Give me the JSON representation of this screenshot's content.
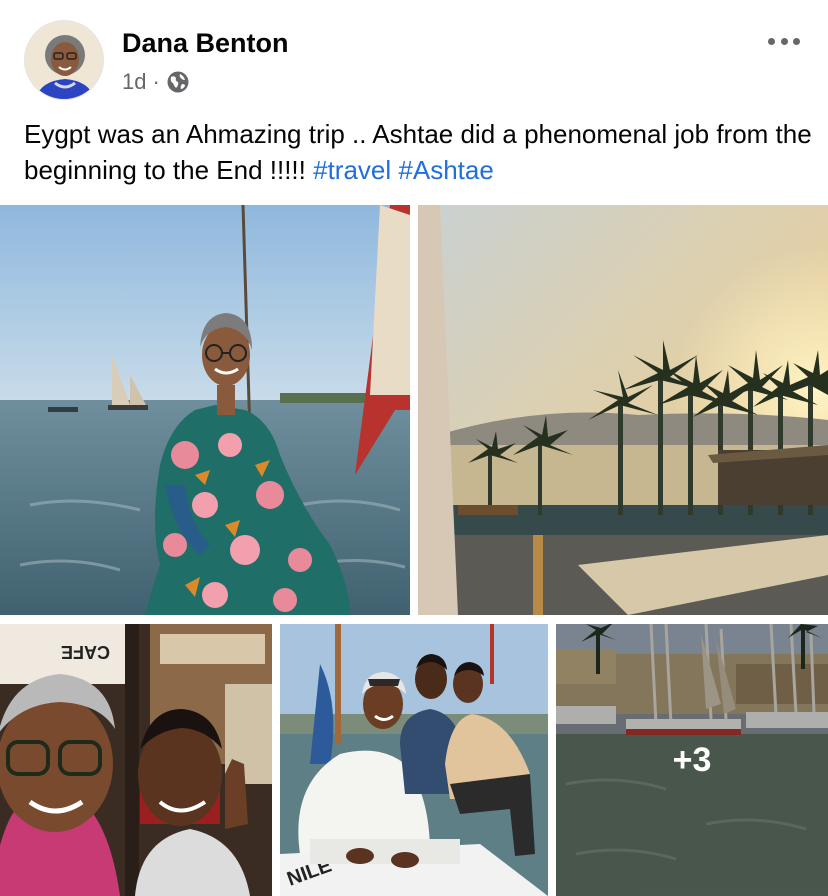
{
  "post": {
    "author": "Dana Benton",
    "time": "1d",
    "dot": "·",
    "audience_icon": "globe-icon",
    "menu_icon": "more-options-icon",
    "text": "Eygpt was an Ahmazing trip .. Ashtae did a phenomenal job from the beginning to the End !!!!! ",
    "hashtags": [
      "#travel",
      "#Ashtae"
    ]
  },
  "photos": {
    "extra_count": "+3",
    "sign_text": "CAFE",
    "boat_text": "NILE"
  },
  "colors": {
    "text": "#050505",
    "secondary": "#65676b",
    "hashtag": "#216fdb"
  }
}
